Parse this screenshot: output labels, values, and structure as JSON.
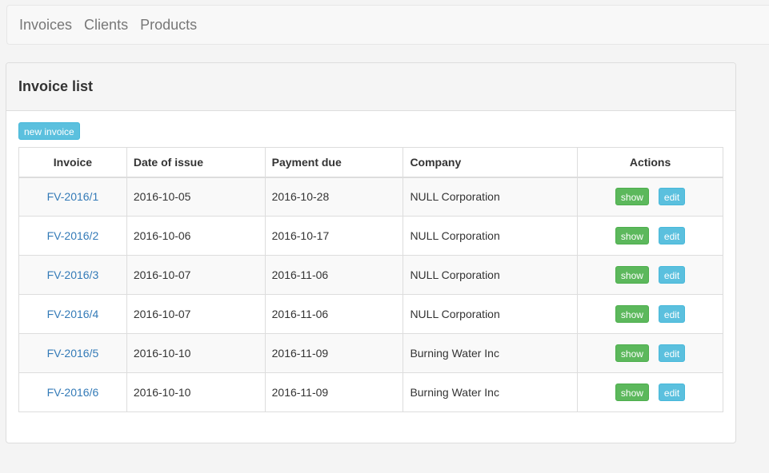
{
  "nav": {
    "items": [
      {
        "label": "Invoices"
      },
      {
        "label": "Clients"
      },
      {
        "label": "Products"
      }
    ]
  },
  "panel": {
    "title": "Invoice list",
    "new_button": "new invoice"
  },
  "table": {
    "headers": {
      "invoice": "Invoice",
      "date_of_issue": "Date of issue",
      "payment_due": "Payment due",
      "company": "Company",
      "actions": "Actions"
    },
    "show_label": "show",
    "edit_label": "edit",
    "rows": [
      {
        "invoice": "FV-2016/1",
        "date_of_issue": "2016-10-05",
        "payment_due": "2016-10-28",
        "company": "NULL Corporation"
      },
      {
        "invoice": "FV-2016/2",
        "date_of_issue": "2016-10-06",
        "payment_due": "2016-10-17",
        "company": "NULL Corporation"
      },
      {
        "invoice": "FV-2016/3",
        "date_of_issue": "2016-10-07",
        "payment_due": "2016-11-06",
        "company": "NULL Corporation"
      },
      {
        "invoice": "FV-2016/4",
        "date_of_issue": "2016-10-07",
        "payment_due": "2016-11-06",
        "company": "NULL Corporation"
      },
      {
        "invoice": "FV-2016/5",
        "date_of_issue": "2016-10-10",
        "payment_due": "2016-11-09",
        "company": "Burning Water Inc"
      },
      {
        "invoice": "FV-2016/6",
        "date_of_issue": "2016-10-10",
        "payment_due": "2016-11-09",
        "company": "Burning Water Inc"
      }
    ]
  },
  "colors": {
    "link": "#337ab7",
    "success": "#5cb85c",
    "info": "#5bc0de"
  }
}
